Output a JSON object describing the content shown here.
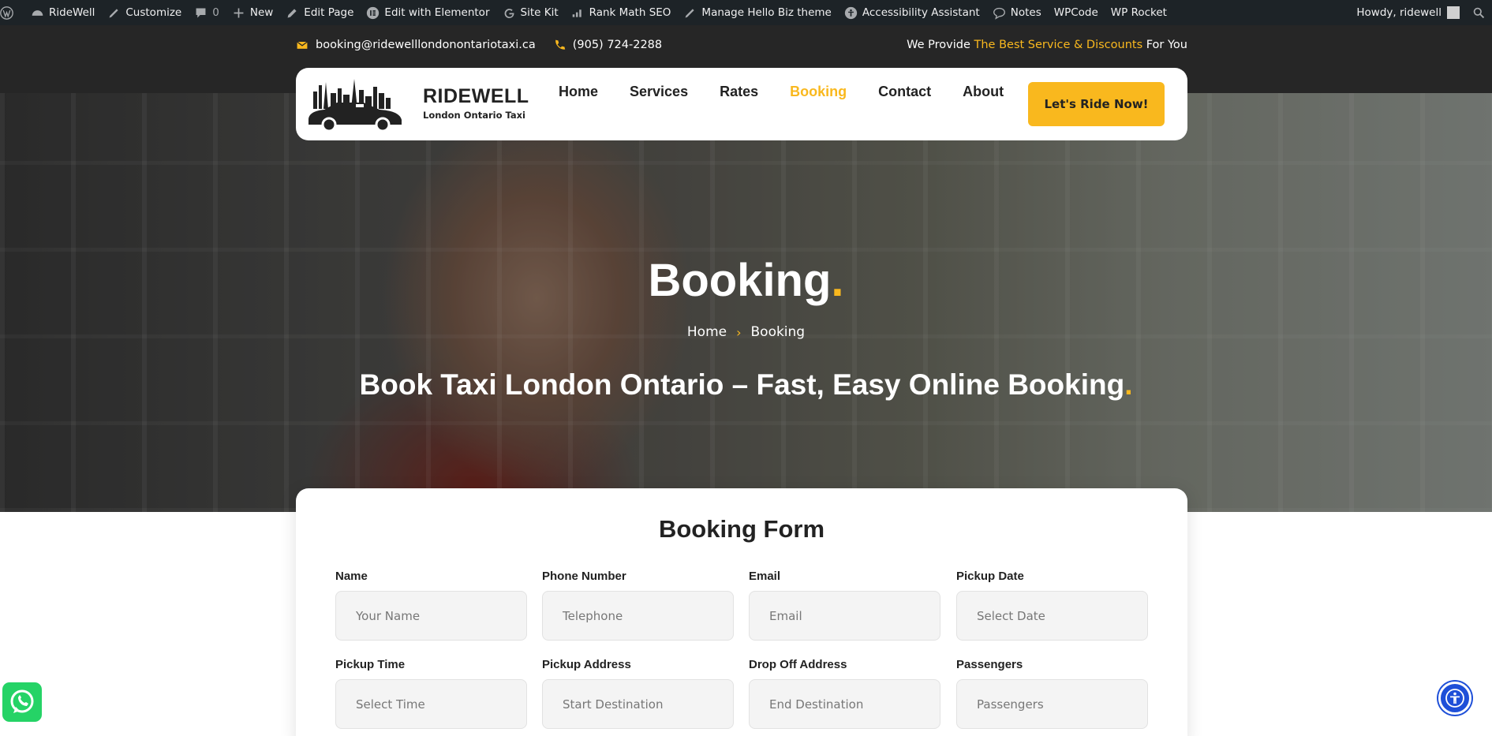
{
  "adminbar": {
    "items": [
      "RideWell",
      "Customize",
      "0",
      "New",
      "Edit Page",
      "Edit with Elementor",
      "Site Kit",
      "Rank Math SEO",
      "Manage Hello Biz theme",
      "Accessibility Assistant",
      "Notes",
      "WPCode",
      "WP Rocket"
    ],
    "greeting": "Howdy, ridewell"
  },
  "topbar": {
    "email": "booking@ridewelllondonontariotaxi.ca",
    "phone": "(905) 724-2288",
    "promo_prefix": "We Provide ",
    "promo_highlight": "The Best Service & Discounts",
    "promo_suffix": " For You"
  },
  "header": {
    "brand_name": "RIDEWELL",
    "brand_tagline": "London Ontario Taxi",
    "nav": [
      "Home",
      "Services",
      "Rates",
      "Booking",
      "Contact",
      "About"
    ],
    "active_nav": "Booking",
    "cta": "Let's Ride Now!"
  },
  "hero": {
    "title": "Booking",
    "title_dot": ".",
    "breadcrumb_home": "Home",
    "breadcrumb_sep": "›",
    "breadcrumb_current": "Booking",
    "subtitle": "Book Taxi London Ontario – Fast, Easy Online Booking",
    "subtitle_dot": "."
  },
  "form": {
    "title": "Booking Form",
    "fields": [
      {
        "label": "Name",
        "placeholder": "Your Name"
      },
      {
        "label": "Phone Number",
        "placeholder": "Telephone"
      },
      {
        "label": "Email",
        "placeholder": "Email"
      },
      {
        "label": "Pickup Date",
        "placeholder": "Select Date"
      },
      {
        "label": "Pickup Time",
        "placeholder": "Select Time"
      },
      {
        "label": "Pickup Address",
        "placeholder": "Start Destination"
      },
      {
        "label": "Drop Off Address",
        "placeholder": "End Destination"
      },
      {
        "label": "Passengers",
        "placeholder": "Passengers"
      }
    ]
  },
  "colors": {
    "accent": "#f9b81e",
    "adminbar": "#1d2327",
    "topstrip": "#262626",
    "whatsapp": "#25d366",
    "accessibility": "#1e4fd8"
  }
}
